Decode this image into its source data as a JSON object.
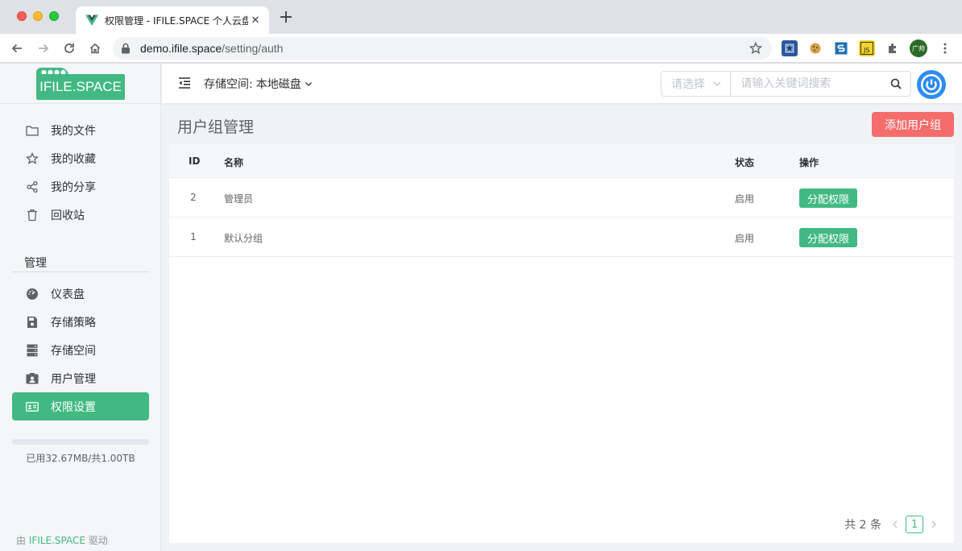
{
  "browser": {
    "tab_title": "权限管理 - IFILE.SPACE 个人云盘",
    "url_host": "demo.ifile.space",
    "url_path": "/setting/auth",
    "profile_label": "广帅"
  },
  "sidebar": {
    "logo_text": "IFILE.SPACE",
    "user_items": [
      {
        "label": "我的文件",
        "icon": "folder-icon"
      },
      {
        "label": "我的收藏",
        "icon": "star-icon"
      },
      {
        "label": "我的分享",
        "icon": "share-icon"
      },
      {
        "label": "回收站",
        "icon": "trash-icon"
      }
    ],
    "admin_title": "管理",
    "admin_items": [
      {
        "label": "仪表盘",
        "icon": "dashboard-icon"
      },
      {
        "label": "存储策略",
        "icon": "save-icon"
      },
      {
        "label": "存储空间",
        "icon": "server-icon"
      },
      {
        "label": "用户管理",
        "icon": "user-card-icon"
      },
      {
        "label": "权限设置",
        "icon": "id-card-icon",
        "active": true
      }
    ],
    "quota_fraction": 3e-05,
    "quota_text": "已用32.67MB/共1.00TB",
    "powered_prefix": "由",
    "powered_brand": "IFILE.SPACE",
    "powered_suffix": "驱动"
  },
  "header": {
    "storage_label": "存储空间:",
    "storage_value": "本地磁盘",
    "select_placeholder": "请选择",
    "search_placeholder": "请输入关键词搜索"
  },
  "main": {
    "page_title": "用户组管理",
    "add_button": "添加用户组",
    "table": {
      "columns": [
        "ID",
        "名称",
        "状态",
        "操作"
      ],
      "rows": [
        {
          "id": "2",
          "name": "管理员",
          "status": "启用",
          "action": "分配权限"
        },
        {
          "id": "1",
          "name": "默认分组",
          "status": "启用",
          "action": "分配权限"
        }
      ]
    },
    "pagination": {
      "total_text": "共 2 条",
      "current_page": "1"
    }
  },
  "colors": {
    "accent": "#42b983",
    "danger": "#f56c6c",
    "power": "#2d8cf0"
  }
}
